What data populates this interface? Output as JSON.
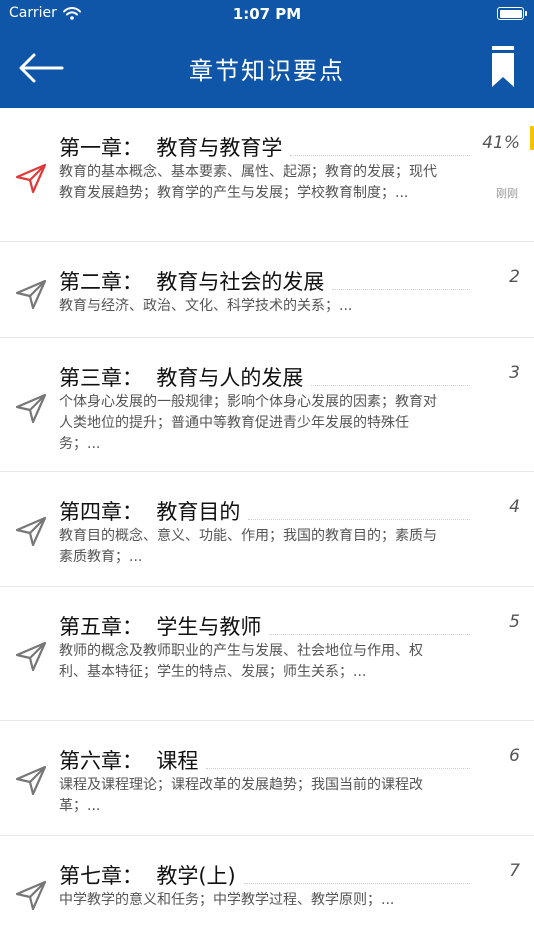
{
  "status_bar": {
    "carrier": "Carrier",
    "time": "1:07 PM"
  },
  "header": {
    "title": "章节知识要点"
  },
  "chapters": [
    {
      "title": "第一章：  教育与教育学",
      "desc": "教育的基本概念、基本要素、属性、起源；教育的发展；现代教育发展趋势；教育学的产生与发展；学校教育制度；...",
      "num": "41%",
      "recent": "刚刚",
      "active": true
    },
    {
      "title": "第二章：  教育与社会的发展",
      "desc": "教育与经济、政治、文化、科学技术的关系；...",
      "num": "2"
    },
    {
      "title": "第三章：  教育与人的发展",
      "desc": "个体身心发展的一般规律；影响个体身心发展的因素；教育对人类地位的提升；普通中等教育促进青少年发展的特殊任务；...",
      "num": "3"
    },
    {
      "title": "第四章：  教育目的",
      "desc": "教育目的概念、意义、功能、作用；我国的教育目的；素质与素质教育；...",
      "num": "4"
    },
    {
      "title": "第五章：  学生与教师",
      "desc": "教师的概念及教师职业的产生与发展、社会地位与作用、权利、基本特征；学生的特点、发展；师生关系；...",
      "num": "5"
    },
    {
      "title": "第六章：  课程",
      "desc": "课程及课程理论；课程改革的发展趋势；我国当前的课程改革；...",
      "num": "6"
    },
    {
      "title": "第七章：  教学(上)",
      "desc": "中学教学的意义和任务；中学教学过程、教学原则；...",
      "num": "7"
    }
  ],
  "colors": {
    "nav_bg": "#0f56a8",
    "active_icon": "#e03a3a",
    "inactive_icon": "#777777",
    "progress_mark": "#f5c400"
  }
}
